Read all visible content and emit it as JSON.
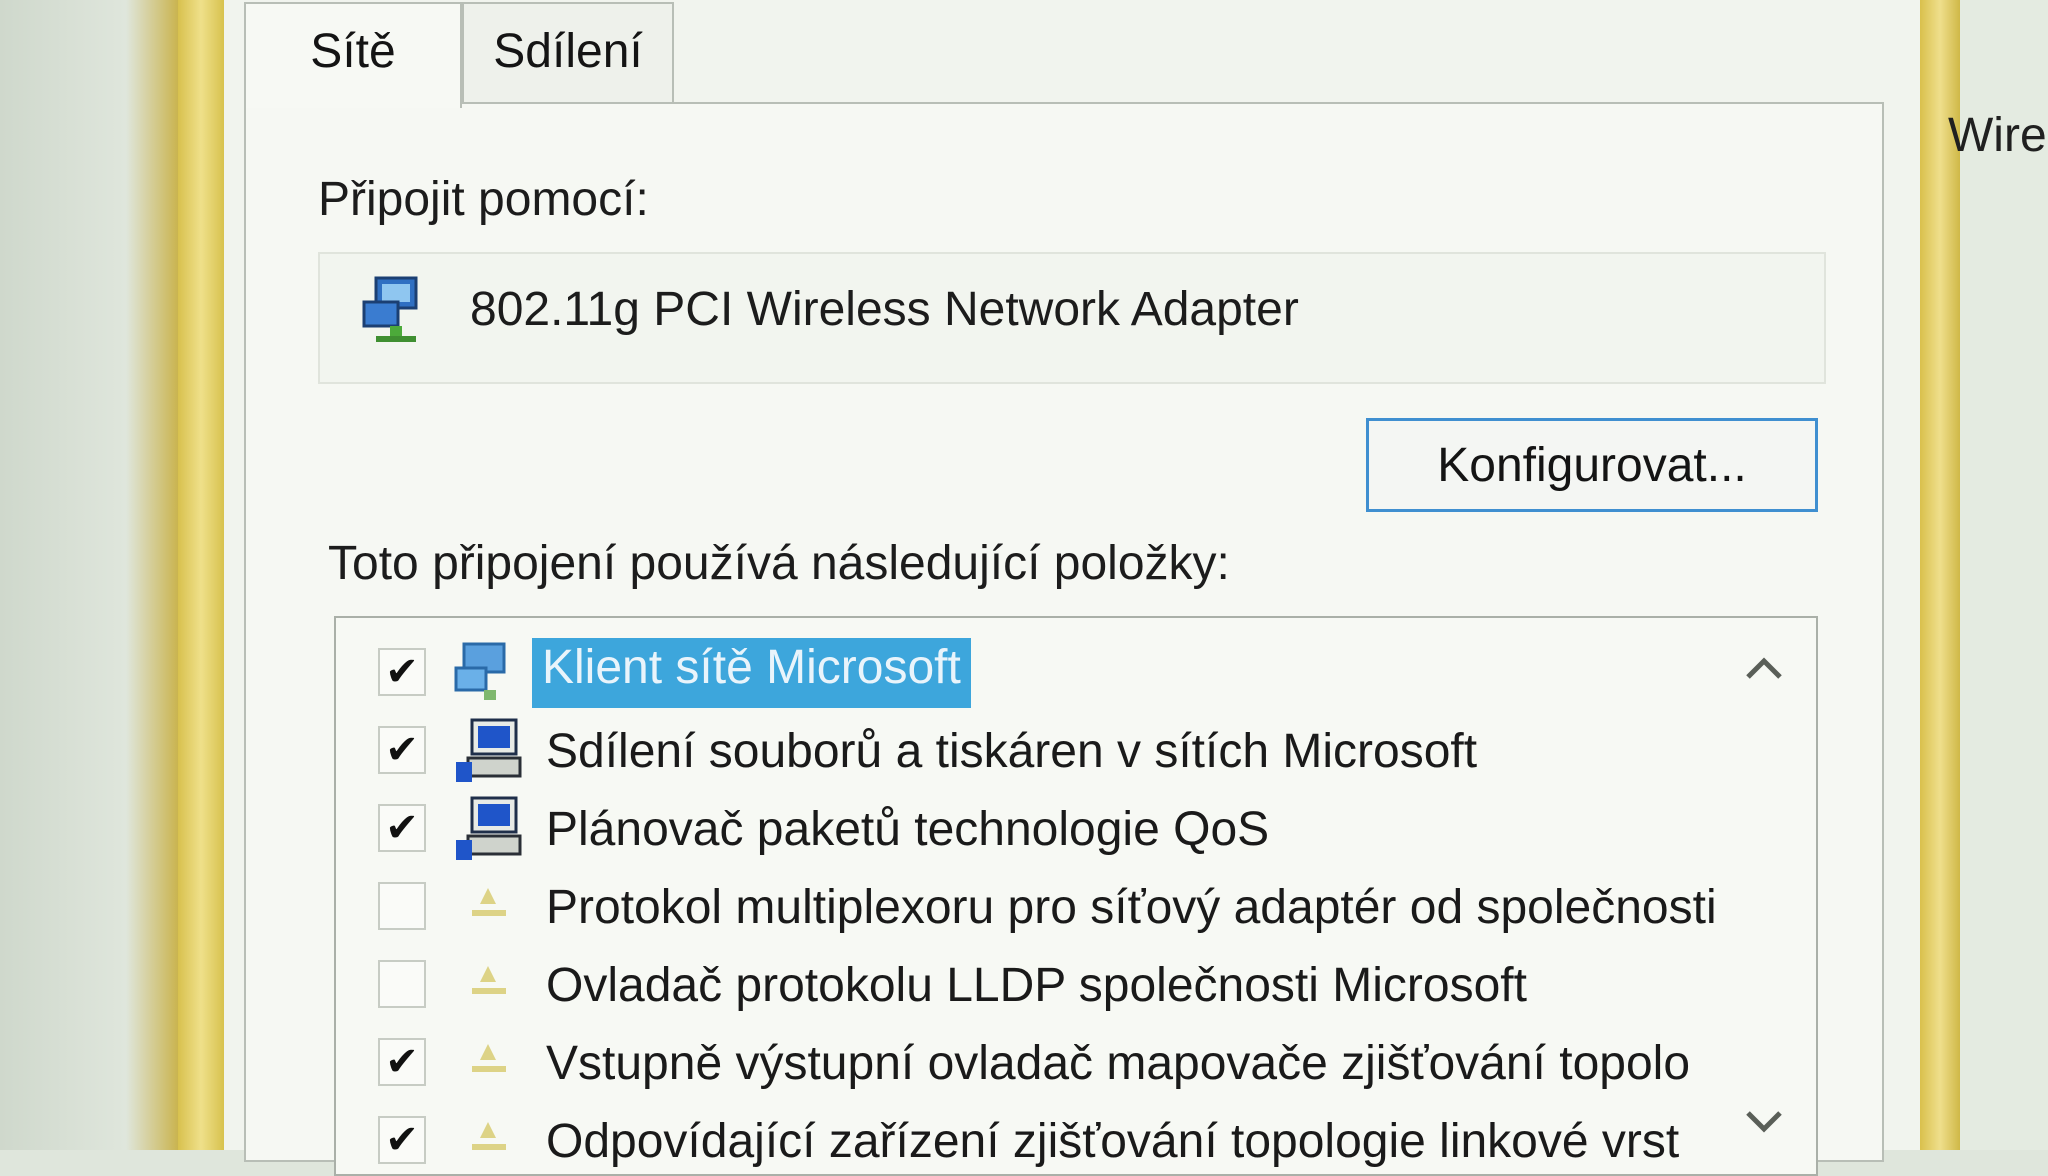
{
  "tabs": [
    {
      "label": "Sítě",
      "active": true
    },
    {
      "label": "Sdílení",
      "active": false
    }
  ],
  "background_window_title": "Wirel",
  "connect_using": {
    "label": "Připojit pomocí:",
    "adapter_name": "802.11g PCI Wireless Network Adapter",
    "adapter_icon": "network-adapter-icon"
  },
  "configure_button": "Konfigurovat...",
  "items_label": "Toto připojení používá následující položky:",
  "items": [
    {
      "label": "Klient sítě Microsoft",
      "checked": true,
      "selected": true,
      "icon": "network-client-icon"
    },
    {
      "label": "Sdílení souborů a tiskáren v sítích Microsoft",
      "checked": true,
      "selected": false,
      "icon": "network-service-icon"
    },
    {
      "label": "Plánovač paketů technologie QoS",
      "checked": true,
      "selected": false,
      "icon": "network-service-icon"
    },
    {
      "label": "Protokol multiplexoru pro síťový adaptér od společnosti",
      "checked": false,
      "selected": false,
      "icon": "protocol-icon"
    },
    {
      "label": "Ovladač protokolu LLDP společnosti Microsoft",
      "checked": false,
      "selected": false,
      "icon": "protocol-icon"
    },
    {
      "label": "Vstupně výstupní ovladač mapovače zjišťování topolo",
      "checked": true,
      "selected": false,
      "icon": "protocol-icon"
    },
    {
      "label": "Odpovídající zařízení zjišťování topologie linkové vrst",
      "checked": true,
      "selected": false,
      "icon": "protocol-icon"
    }
  ],
  "checkmark_glyph": "✔",
  "colors": {
    "selection": "#3da6dc",
    "button_border": "#3f8fd0",
    "frame": "#d8c14e"
  }
}
